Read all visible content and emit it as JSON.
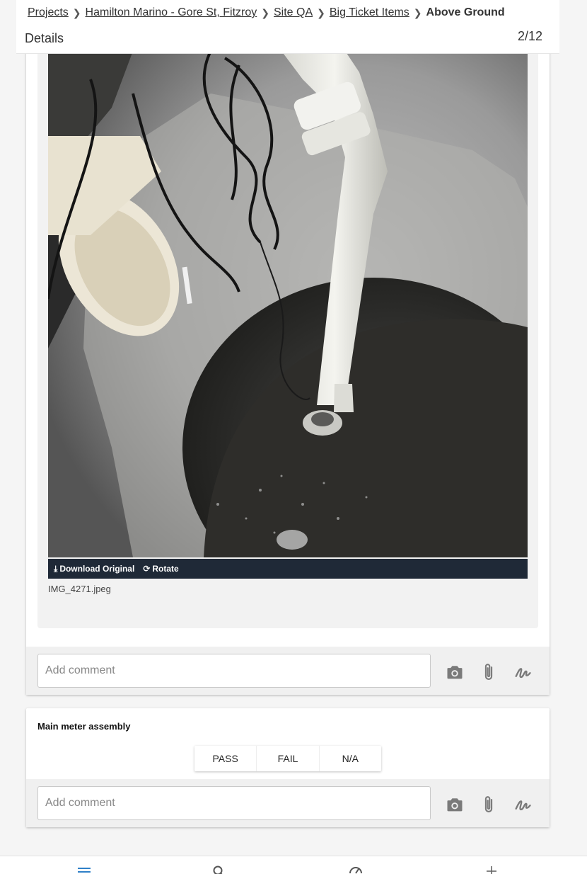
{
  "breadcrumb": {
    "items": [
      "Projects",
      "Hamilton Marino - Gore St, Fitzroy",
      "Site QA",
      "Big Ticket Items"
    ],
    "current": "Above Ground"
  },
  "header": {
    "title": "Details",
    "page_counter": "2/12"
  },
  "photo": {
    "download_label": "Download Original",
    "rotate_label": "Rotate",
    "filename": "IMG_4271.jpeg",
    "toolbar_color": "#1f2937"
  },
  "comment1": {
    "placeholder": "Add comment"
  },
  "checklist_item": {
    "title": "Main meter assembly",
    "options": [
      "PASS",
      "FAIL",
      "N/A"
    ]
  },
  "comment2": {
    "placeholder": "Add comment"
  },
  "icons": [
    "camera-icon",
    "paperclip-icon",
    "signature-icon",
    "menu-icon",
    "search-icon",
    "dashboard-icon",
    "plus-icon"
  ],
  "colors": {
    "accent": "#2f80c8",
    "icon_gray": "#7a7a7a"
  }
}
